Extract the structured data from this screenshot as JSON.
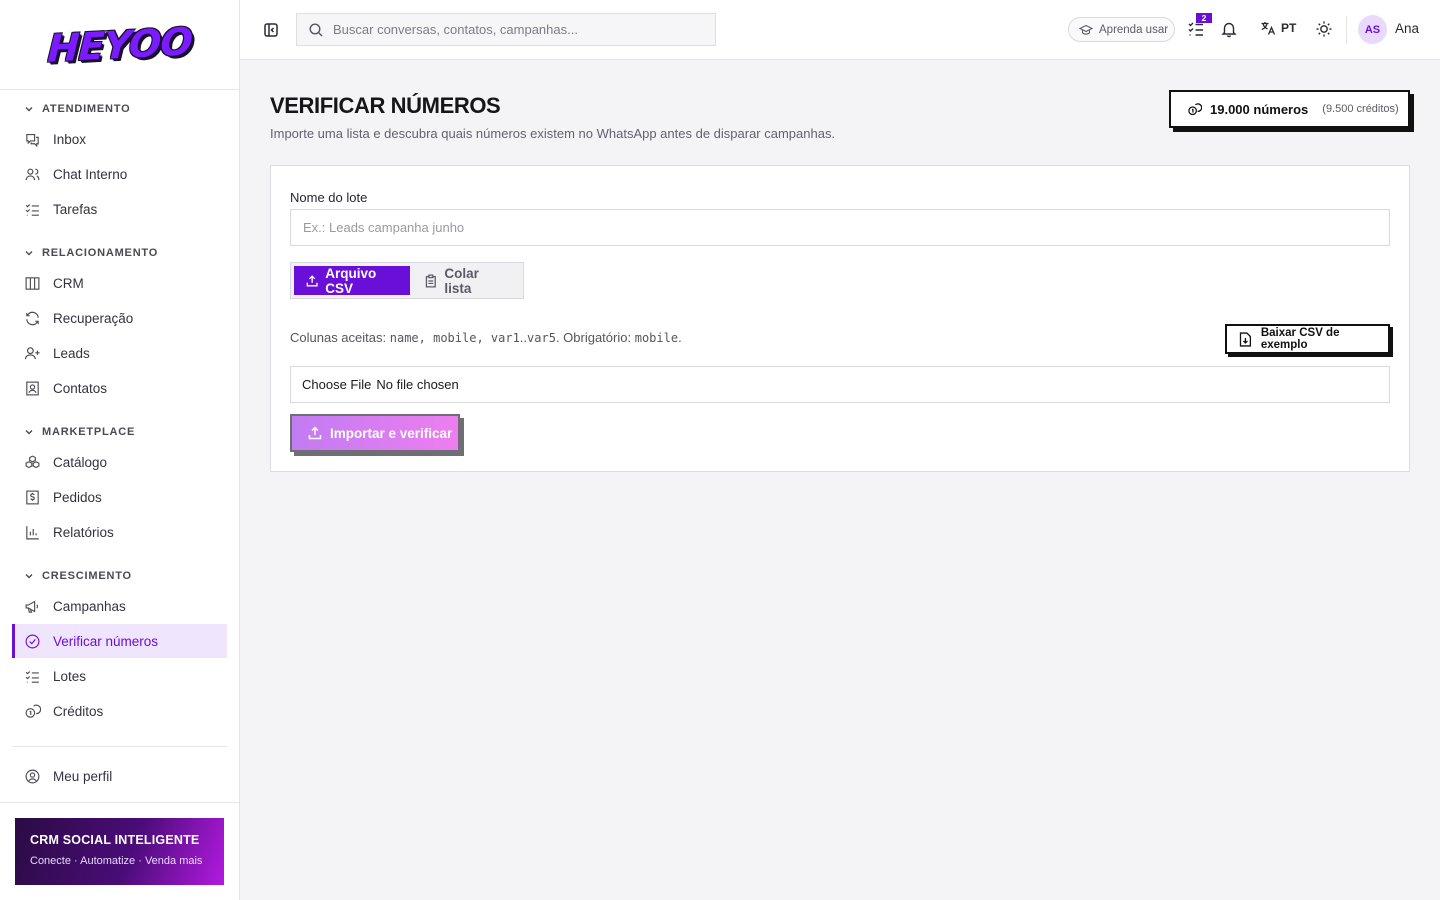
{
  "brand": {
    "logo_text": "HEYOO"
  },
  "sidebar": {
    "sections": [
      {
        "title": "ATENDIMENTO",
        "items": [
          {
            "label": "Inbox",
            "icon": "inbox-icon"
          },
          {
            "label": "Chat Interno",
            "icon": "users-icon"
          },
          {
            "label": "Tarefas",
            "icon": "list-checks-icon"
          }
        ]
      },
      {
        "title": "RELACIONAMENTO",
        "items": [
          {
            "label": "CRM",
            "icon": "columns-icon"
          },
          {
            "label": "Recuperação",
            "icon": "refresh-icon"
          },
          {
            "label": "Leads",
            "icon": "user-plus-icon"
          },
          {
            "label": "Contatos",
            "icon": "contact-icon"
          }
        ]
      },
      {
        "title": "MARKETPLACE",
        "items": [
          {
            "label": "Catálogo",
            "icon": "boxes-icon"
          },
          {
            "label": "Pedidos",
            "icon": "receipt-dollar-icon"
          },
          {
            "label": "Relatórios",
            "icon": "bar-chart-icon"
          }
        ]
      },
      {
        "title": "CRESCIMENTO",
        "items": [
          {
            "label": "Campanhas",
            "icon": "megaphone-icon"
          },
          {
            "label": "Verificar números",
            "icon": "check-circle-icon",
            "active": true
          },
          {
            "label": "Lotes",
            "icon": "list-checks-icon"
          },
          {
            "label": "Créditos",
            "icon": "coins-icon"
          }
        ]
      }
    ],
    "profile_label": "Meu perfil",
    "promo": {
      "title": "CRM SOCIAL INTELIGENTE",
      "subtitle": "Conecte · Automatize · Venda mais"
    }
  },
  "header": {
    "search_placeholder": "Buscar conversas, contatos, campanhas...",
    "learn_label": "Aprenda usar",
    "tasks_badge": "2",
    "language": "PT",
    "avatar_initials": "AS",
    "user_name": "Ana"
  },
  "page": {
    "title": "VERIFICAR NÚMEROS",
    "subtitle": "Importe uma lista e descubra quais números existem no WhatsApp antes de disparar campanhas.",
    "credits_main": "19.000 números",
    "credits_sub": "(9.500 créditos)"
  },
  "form": {
    "batch_label": "Nome do lote",
    "batch_placeholder": "Ex.: Leads campanha junho",
    "tab_csv": "Arquivo CSV",
    "tab_paste": "Colar lista",
    "accepted_prefix": "Colunas aceitas:",
    "accepted_cols": "name, mobile, var1",
    "accepted_range": "..",
    "accepted_last": "var5",
    "required_prefix": ". Obrigatório:",
    "required_col": "mobile",
    "required_suffix": ".",
    "download_label": "Baixar CSV de exemplo",
    "choose_file": "Choose File",
    "no_file": "No file chosen",
    "submit_label": "Importar e verificar"
  },
  "colors": {
    "accent": "#6a0fd8",
    "active_bg": "#efe5fd"
  }
}
